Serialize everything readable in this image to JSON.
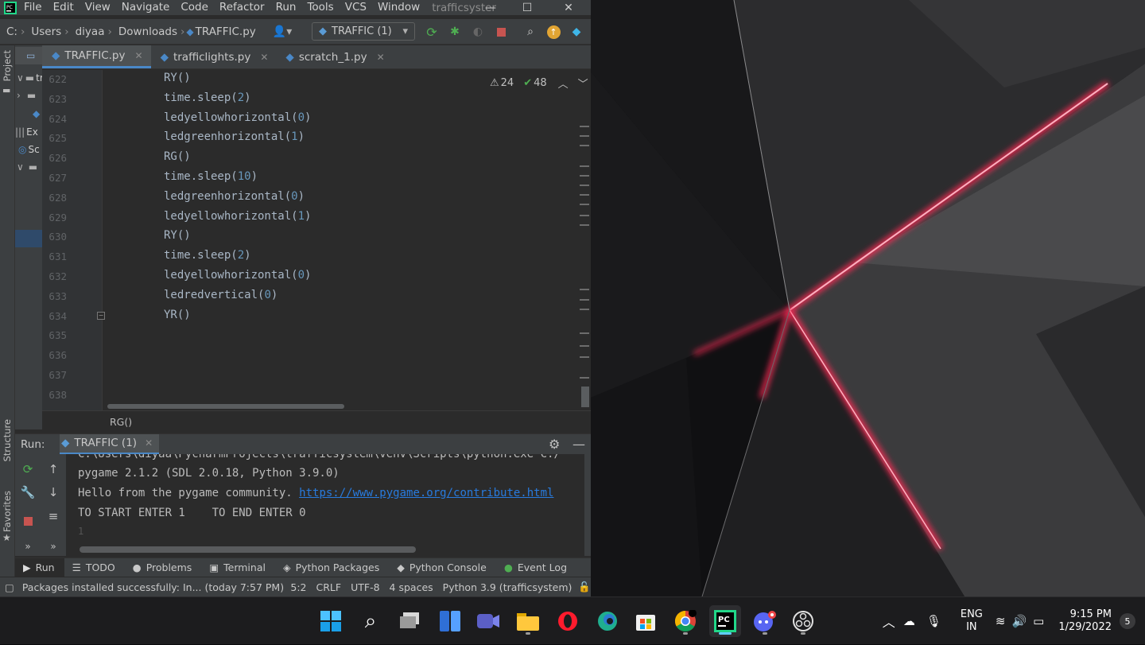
{
  "menu": {
    "items": [
      "File",
      "Edit",
      "View",
      "Navigate",
      "Code",
      "Refactor",
      "Run",
      "Tools",
      "VCS",
      "Window"
    ],
    "project_name": "trafficsyster",
    "window_buttons": {
      "minimize": "—",
      "maximize": "☐",
      "close": "✕"
    }
  },
  "navbar": {
    "breadcrumb": [
      "C:",
      "Users",
      "diyaa",
      "Downloads",
      "TRAFFIC.py"
    ],
    "run_config": "TRAFFIC (1)"
  },
  "tabs": [
    {
      "label": "TRAFFIC.py",
      "active": true
    },
    {
      "label": "trafficlights.py",
      "active": false
    },
    {
      "label": "scratch_1.py",
      "active": false
    }
  ],
  "project_pane": {
    "rows": [
      "tr",
      "",
      "",
      "Ex",
      "Sc",
      ""
    ]
  },
  "inspections": {
    "warnings": "24",
    "ok": "48"
  },
  "editor": {
    "lines": [
      {
        "num": "622",
        "fn": "RY",
        "arg": ""
      },
      {
        "num": "623",
        "fn": "time.sleep",
        "arg": "2"
      },
      {
        "num": "624",
        "fn": "ledyellowhorizontal",
        "arg": "0"
      },
      {
        "num": "625",
        "fn": "ledgreenhorizontal",
        "arg": "1"
      },
      {
        "num": "626",
        "fn": "RG",
        "arg": ""
      },
      {
        "num": "627",
        "fn": "time.sleep",
        "arg": "10"
      },
      {
        "num": "628",
        "fn": "ledgreenhorizontal",
        "arg": "0"
      },
      {
        "num": "629",
        "fn": "ledyellowhorizontal",
        "arg": "1"
      },
      {
        "num": "630",
        "fn": "RY",
        "arg": ""
      },
      {
        "num": "631",
        "fn": "time.sleep",
        "arg": "2"
      },
      {
        "num": "632",
        "fn": "ledyellowhorizontal",
        "arg": "0"
      },
      {
        "num": "633",
        "fn": "ledredvertical",
        "arg": "0"
      },
      {
        "num": "634",
        "fn": "YR",
        "arg": ""
      },
      {
        "num": "635",
        "fn": "",
        "arg": ""
      },
      {
        "num": "636",
        "fn": "",
        "arg": ""
      },
      {
        "num": "637",
        "fn": "",
        "arg": ""
      },
      {
        "num": "638",
        "fn": "",
        "arg": ""
      }
    ],
    "breadcrumb": "RG()"
  },
  "left_strip": {
    "project": "Project",
    "structure": "Structure",
    "favorites": "Favorites"
  },
  "run": {
    "label": "Run:",
    "tab": "TRAFFIC (1)",
    "console": [
      "C:\\Users\\diyaa\\PycharmProjects\\trafficsystem\\venv\\Scripts\\python.exe C:/",
      "pygame 2.1.2 (SDL 2.0.18, Python 3.9.0)",
      "Hello from the pygame community. ",
      "TO START ENTER 1    TO END ENTER 0",
      "1"
    ],
    "link": "https://www.pygame.org/contribute.html"
  },
  "tool_tabs": [
    "Run",
    "TODO",
    "Problems",
    "Terminal",
    "Python Packages",
    "Python Console",
    "Event Log"
  ],
  "status": {
    "message": "Packages installed successfully: In... (today 7:57 PM)",
    "position": "5:2",
    "line_sep": "CRLF",
    "encoding": "UTF-8",
    "indent": "4 spaces",
    "interpreter": "Python 3.9 (trafficsystem)"
  },
  "tray": {
    "lang": "ENG",
    "region": "IN",
    "time": "9:15 PM",
    "date": "1/29/2022",
    "notif": "5"
  },
  "colors": {
    "accent": "#4a88c7",
    "number": "#6897bb",
    "code": "#a9b7c6",
    "wallpaper_glow": "#ff2a55"
  }
}
